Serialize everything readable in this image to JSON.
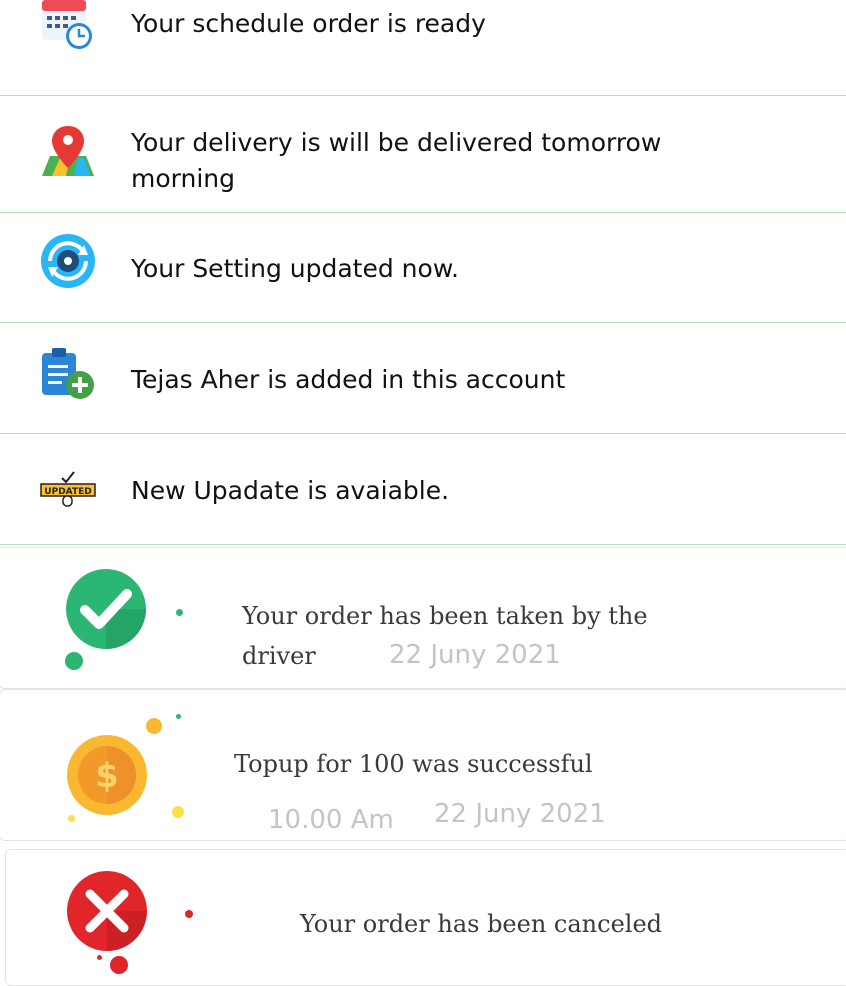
{
  "notifications": [
    {
      "icon": "calendar-clock-icon",
      "text": "Your schedule order is ready"
    },
    {
      "icon": "map-pin-icon",
      "text": "Your delivery is will be delivered tomorrow morning"
    },
    {
      "icon": "settings-sync-icon",
      "text": "Your Setting updated now."
    },
    {
      "icon": "clipboard-add-icon",
      "text": "Tejas Aher is added in this account"
    },
    {
      "icon": "updated-badge-icon",
      "text": "New Upadate is avaiable."
    }
  ],
  "updated_badge_label": "UPDATED",
  "cards": {
    "taken": {
      "icon": "check-circle-icon",
      "message_line1": "Your order has been taken by the",
      "message_line2": "driver",
      "date": "22 Juny 2021"
    },
    "topup": {
      "icon": "dollar-coin-icon",
      "currency_symbol": "$",
      "message": "Topup for 100 was successful",
      "time": "10.00 Am",
      "date": "22 Juny 2021"
    },
    "canceled": {
      "icon": "cancel-circle-icon",
      "message": "Your order has been canceled"
    }
  },
  "colors": {
    "divider": "#b5e0bd",
    "success": "#2bb673",
    "coin": "#f9b830",
    "error": "#e0252b"
  }
}
